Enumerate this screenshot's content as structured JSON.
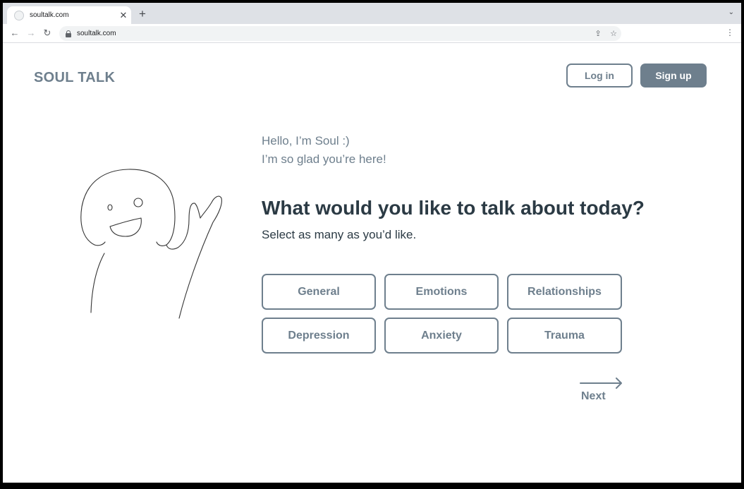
{
  "browser": {
    "tab_title": "soultalk.com",
    "tab_close": "✕",
    "new_tab": "+",
    "url": "soultalk.com"
  },
  "header": {
    "logo": "SOUL TALK",
    "login_label": "Log in",
    "signup_label": "Sign up"
  },
  "main": {
    "greeting_line1": "Hello, I’m Soul :)",
    "greeting_line2": "I’m so glad you’re here!",
    "question": "What would you like to talk about today?",
    "subtitle": "Select as many as you’d like.",
    "topics": [
      "General",
      "Emotions",
      "Relationships",
      "Depression",
      "Anxiety",
      "Trauma"
    ],
    "next_label": "Next"
  },
  "colors": {
    "accent": "#6e7f8d",
    "heading": "#2b3a44",
    "background": "#ffffff"
  }
}
